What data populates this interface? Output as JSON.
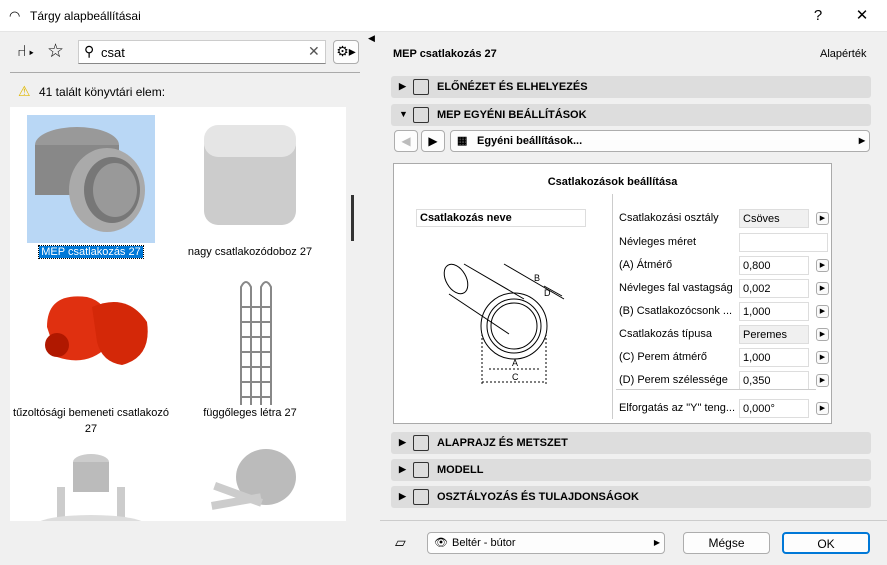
{
  "window": {
    "title": "Tárgy alapbeállításai",
    "help": "?",
    "close": "✕"
  },
  "library": {
    "search_value": "csat",
    "result_text": "41 talált könyvtári elem:",
    "items": [
      {
        "label": "MEP csatlakozás 27"
      },
      {
        "label": "nagy csatlakozódoboz 27"
      },
      {
        "label": "tűzoltósági bemeneti csatlakozó 27"
      },
      {
        "label": "függőleges létra 27"
      }
    ]
  },
  "header": {
    "title": "MEP csatlakozás 27",
    "default_label": "Alapérték"
  },
  "sections": {
    "preview": "ELŐNÉZET ÉS ELHELYEZÉS",
    "mep": "MEP EGYÉNI BEÁLLÍTÁSOK",
    "plan": "ALAPRAJZ ÉS METSZET",
    "model": "MODELL",
    "classification": "OSZTÁLYOZÁS ÉS TULAJDONSÁGOK"
  },
  "custom_nav": {
    "page": "Egyéni beállítások..."
  },
  "panel": {
    "title": "Csatlakozások beállítása",
    "name_field": "Csatlakozás neve",
    "diagram_labels": {
      "a": "A",
      "b": "B",
      "c": "C",
      "d": "D"
    },
    "params": [
      {
        "label": "Csatlakozási osztály",
        "value": "Csöves"
      },
      {
        "label": "Névleges méret",
        "value": ""
      },
      {
        "label": "(A) Átmérő",
        "value": "0,800"
      },
      {
        "label": "Névleges fal vastagság",
        "value": "0,002"
      },
      {
        "label": "(B) Csatlakozócsonk ...",
        "value": "1,000"
      },
      {
        "label": "Csatlakozás típusa",
        "value": "Peremes"
      },
      {
        "label": "(C) Perem átmérő",
        "value": "1,000"
      },
      {
        "label": "(D) Perem szélessége",
        "value": "0,350"
      },
      {
        "label": "Elforgatás az \"Y\" teng...",
        "value": "0,000°"
      }
    ]
  },
  "footer": {
    "layer": "Beltér - bútor",
    "cancel": "Mégse",
    "ok": "OK"
  },
  "colors": {
    "accent": "#0078d7",
    "selection": "#b9d7f5",
    "section_bg": "#dddddd"
  }
}
